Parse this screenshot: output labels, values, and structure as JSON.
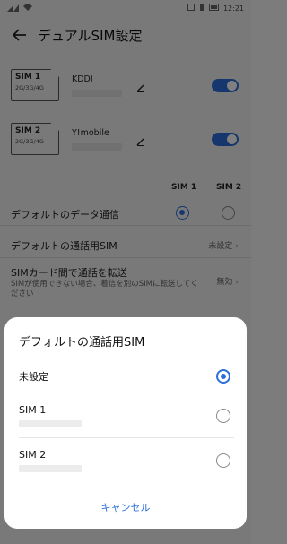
{
  "statusbar": {
    "time": "12:21"
  },
  "header": {
    "title": "デュアルSIM設定"
  },
  "sims": [
    {
      "name": "SIM 1",
      "bands": "2G/3G/4G",
      "carrier": "KDDI",
      "enabled": true
    },
    {
      "name": "SIM 2",
      "bands": "2G/3G/4G",
      "carrier": "Y!mobile",
      "enabled": true
    }
  ],
  "data_section": {
    "col1": "SIM 1",
    "col2": "SIM 2",
    "label": "デフォルトのデータ通信",
    "selected": "SIM 1"
  },
  "call_sim": {
    "label": "デフォルトの通話用SIM",
    "value": "未設定"
  },
  "forward": {
    "label": "SIMカード間で通話を転送",
    "description": "SIMが使用できない場合、着信を別のSIMに転送してください",
    "value": "無効"
  },
  "dialog": {
    "title": "デフォルトの通話用SIM",
    "options": [
      {
        "label": "未設定",
        "selected": true
      },
      {
        "label": "SIM 1",
        "selected": false
      },
      {
        "label": "SIM 2",
        "selected": false
      }
    ],
    "cancel_label": "キャンセル"
  },
  "colors": {
    "accent": "#2a6fdb"
  }
}
